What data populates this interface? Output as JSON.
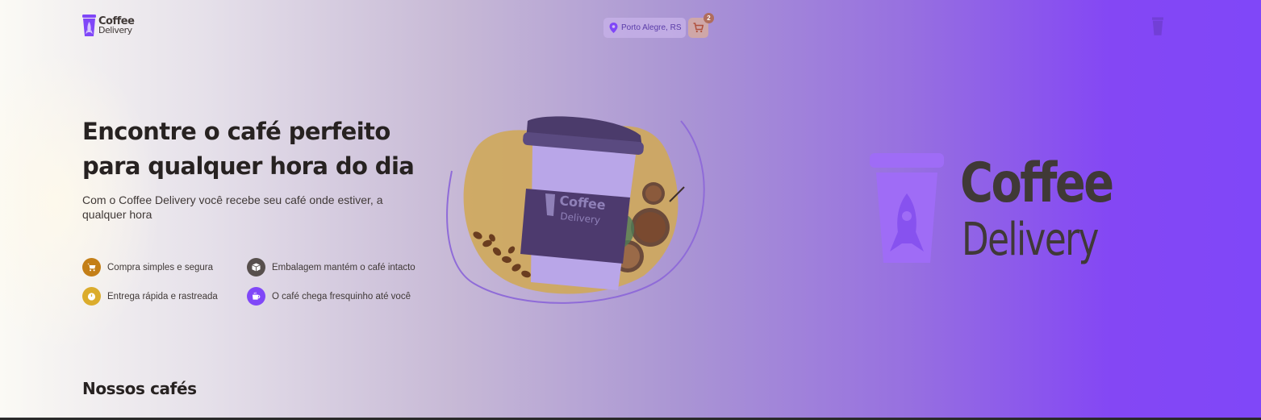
{
  "header": {
    "logo": {
      "word1": "Coffee",
      "word2": "Delivery",
      "icon": "rocket-cup-icon"
    },
    "location": {
      "label": "Porto Alegre, RS",
      "icon": "map-pin-icon"
    },
    "cart": {
      "icon": "shopping-cart-icon",
      "count": "2"
    }
  },
  "hero": {
    "title": "Encontre o café perfeito para qualquer hora do dia",
    "subtitle": "Com o Coffee Delivery você recebe seu café onde estiver, a qualquer hora",
    "features": [
      {
        "label": "Compra simples e segura",
        "icon": "shopping-cart-icon",
        "color": "#c47f17"
      },
      {
        "label": "Embalagem mantém o café intacto",
        "icon": "package-icon",
        "color": "#574f4d"
      },
      {
        "label": "Entrega rápida e rastreada",
        "icon": "timer-icon",
        "color": "#dbac2c"
      },
      {
        "label": "O café chega fresquinho até você",
        "icon": "coffee-icon",
        "color": "#8047f8"
      }
    ],
    "cup_label": {
      "word1": "Coffee",
      "word2": "Delivery"
    }
  },
  "brand_logo": {
    "word1": "Coffee",
    "word2": "Delivery"
  },
  "section": {
    "title": "Nossos cafés"
  },
  "colors": {
    "purple": "#8047f8",
    "yellow": "#dbac2c",
    "yellow_dark": "#c47f17",
    "base_text": "#403937"
  }
}
